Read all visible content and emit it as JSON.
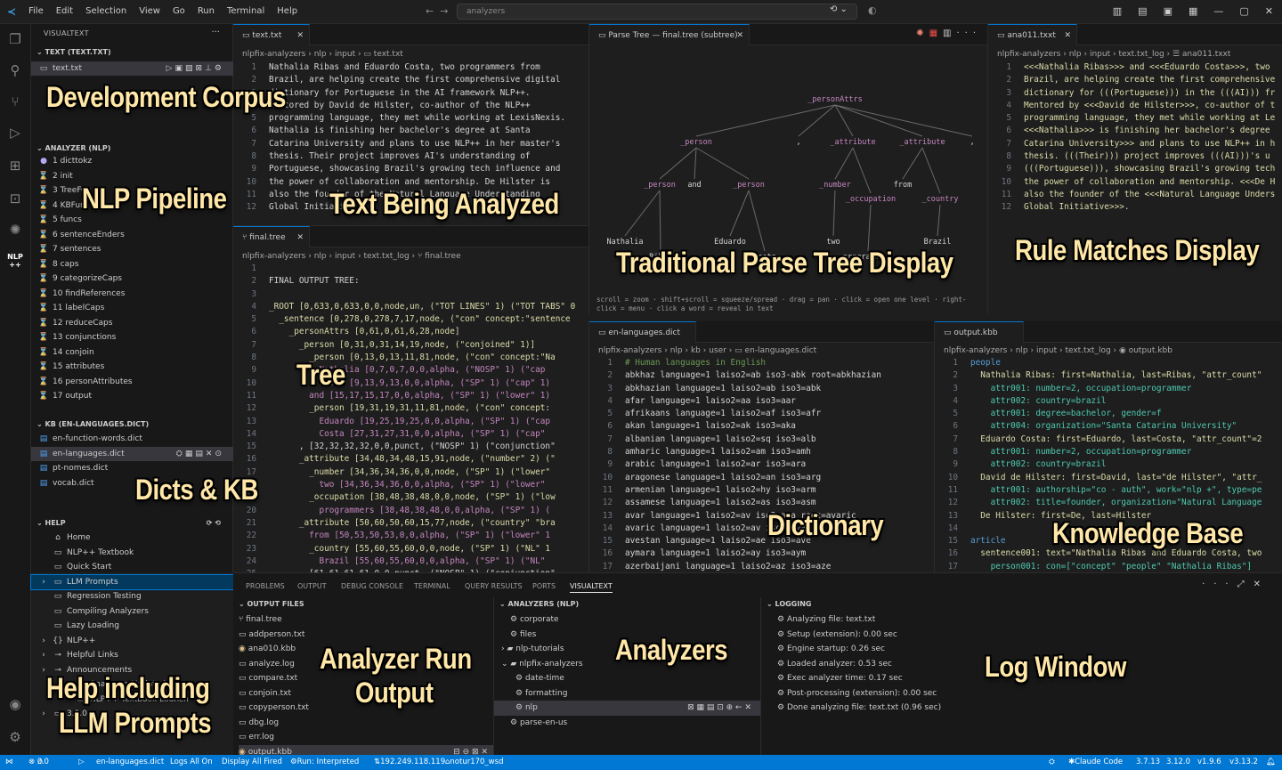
{
  "titlebar": {
    "menu": [
      "File",
      "Edit",
      "Selection",
      "View",
      "Go",
      "Run",
      "Terminal",
      "Help"
    ],
    "search_value": "analyzers"
  },
  "sidebar": {
    "header": "VISUALTEXT",
    "text_section": "TEXT (TEXT.TXT)",
    "text_file": "text.txt",
    "analyzer_section": "ANALYZER (NLP)",
    "passes": [
      "1 dicttokz",
      "2 init",
      "3 TreeFun",
      "4 KBFun",
      "5 funcs",
      "6 sentenceEnders",
      "7 sentences",
      "8 caps",
      "9 categorizeCaps",
      "10 findReferences",
      "11 labelCaps",
      "12 reduceCaps",
      "13 conjunctions",
      "14 conjoin",
      "15 attributes",
      "16 personAttributes",
      "17 output"
    ],
    "kb_section": "KB (EN-LANGUAGES.DICT)",
    "kb_files": [
      "en-function-words.dict",
      "en-languages.dict",
      "pt-nomes.dict",
      "vocab.dict"
    ],
    "help_section": "HELP",
    "help_items": [
      "Home",
      "NLP++ Textbook",
      "Quick Start",
      "LLM Prompts",
      "Regression Testing",
      "Compiling Analyzers",
      "Lazy Loading",
      "NLP++",
      "Helpful Links",
      "Announcements",
      "Analyzers Updated",
      "NLP++ Textbook Launch",
      "3.9.0"
    ]
  },
  "editor1": {
    "tab": "text.txt",
    "crumb": [
      "nlpfix-analyzers",
      "nlp",
      "input",
      "text.txt"
    ],
    "lines": [
      "Nathalia Ribas and Eduardo Costa, two programmers from",
      "Brazil, are helping create the first comprehensive digital",
      "dictionary for Portuguese in the AI framework NLP++.",
      "Mentored by David de Hilster, co-author of the NLP++",
      "programming language, they met while working at LexisNexis.",
      "Nathalia is finishing her bachelor's degree at Santa",
      "Catarina University and plans to use NLP++ in her master's",
      "thesis. Their project improves AI's understanding of",
      "Portuguese, showcasing Brazil's growing tech influence and",
      "the power of collaboration and mentorship. De Hilster is",
      "also the founder of the Natural Language Understanding",
      "Global Initiative."
    ]
  },
  "editor2": {
    "tab": "final.tree",
    "crumb": [
      "nlpfix-analyzers",
      "nlp",
      "input",
      "text.txt_log",
      "final.tree"
    ],
    "lines": [
      "",
      "FINAL OUTPUT TREE:",
      "",
      "_ROOT [0,633,0,633,0,0,node,un, (\"TOT LINES\" 1) (\"TOT TABS\" 0",
      "  _sentence [0,278,0,278,7,17,node, (\"con\" concept:\"sentence",
      "    _personAttrs [0,61,0,61,6,28,node]",
      "      _person [0,31,0,31,14,19,node, (\"conjoined\" 1)]",
      "        _person [0,13,0,13,11,81,node, (\"con\" concept:\"Na",
      "          Nathalia [0,7,0,7,0,0,alpha, (\"NOSP\" 1) (\"cap",
      "          Ribas [9,13,9,13,0,0,alpha, (\"SP\" 1) (\"cap\" 1)",
      "        and [15,17,15,17,0,0,alpha, (\"SP\" 1) (\"lower\" 1)",
      "        _person [19,31,19,31,11,81,node, (\"con\" concept:",
      "          Eduardo [19,25,19,25,0,0,alpha, (\"SP\" 1) (\"cap",
      "          Costa [27,31,27,31,0,0,alpha, (\"SP\" 1) (\"cap\"",
      "      , [32,32,32,32,0,0,punct, (\"NOSP\" 1) (\"conjunction\"",
      "      _attribute [34,48,34,48,15,91,node, (\"number\" 2) (\"",
      "        _number [34,36,34,36,0,0,node, (\"SP\" 1) (\"lower\"",
      "          two [34,36,34,36,0,0,alpha, (\"SP\" 1) (\"lower\"",
      "        _occupation [38,48,38,48,0,0,node, (\"SP\" 1) (\"low",
      "          programmers [38,48,38,48,0,0,alpha, (\"SP\" 1) (",
      "      _attribute [50,60,50,60,15,77,node, (\"country\" \"bra",
      "        from [50,53,50,53,0,0,alpha, (\"SP\" 1) (\"lower\" 1",
      "        _country [55,60,55,60,0,0,node, (\"SP\" 1) (\"NL\" 1",
      "          Brazil [55,60,55,60,0,0,alpha, (\"SP\" 1) (\"NL\"",
      "      , [61,61,61,61,0,0,punct, (\"NOSP\" 1) (\"conjunction\""
    ]
  },
  "parsetree": {
    "tab": "Parse Tree — final.tree (subtree)",
    "nodes": [
      "_personAttrs",
      "_person",
      ",",
      "_attribute",
      "_attribute",
      ",",
      "_person",
      "and",
      "_person",
      "_number",
      "from",
      "_occupation",
      "_country",
      "Nathalia",
      "Ribas",
      "Eduardo",
      "Costa",
      "two",
      "programmers",
      "Brazil"
    ],
    "help": "scroll = zoom · shift+scroll = squeeze/spread · drag = pan · click = open one level · right-click = menu · click a word = reveal in text"
  },
  "editor3": {
    "tab": "ana011.txxt",
    "crumb": [
      "nlpfix-analyzers",
      "nlp",
      "input",
      "text.txt_log",
      "ana011.txxt"
    ],
    "lines": [
      "<<<Nathalia Ribas>>> and <<<Eduardo Costa>>>, two",
      "Brazil, are helping create the first comprehensive",
      "dictionary for (((Portuguese))) in the (((AI))) fr",
      "Mentored by <<<David de Hilster>>>, co-author of t",
      "programming language, they met while working at Le",
      "<<<Nathalia>>> is finishing her bachelor's degree",
      "Catarina University>>> and plans to use NLP++ in h",
      "thesis. (((Their))) project improves (((AI)))'s u",
      "(((Portuguese))), showcasing Brazil's growing tech",
      "the power of collaboration and mentorship. <<<De H",
      "also the founder of the <<<Natural Language Unders",
      "Global Initiative>>>."
    ]
  },
  "editor4": {
    "tab": "en-languages.dict",
    "crumb": [
      "nlpfix-analyzers",
      "nlp",
      "kb",
      "user",
      "en-languages.dict"
    ],
    "lines": [
      "# Human languages in English",
      "abkhaz language=1 laiso2=ab iso3-abk root=abkhazian",
      "abkhazian language=1 laiso2=ab iso3=abk",
      "afar language=1 laiso2=aa iso3=aar",
      "afrikaans language=1 laiso2=af iso3=afr",
      "akan language=1 laiso2=ak iso3=aka",
      "albanian language=1 laiso2=sq iso3=alb",
      "amharic language=1 laiso2=am iso3=amh",
      "arabic language=1 laiso2=ar iso3=ara",
      "aragonese language=1 laiso2=an iso3=arg",
      "armenian language=1 laiso2=hy iso3=arm",
      "assamese language=1 laiso2=as iso3=asm",
      "avar language=1 laiso2=av iso3=ava root=avaric",
      "avaric language=1 laiso2=av iso3=ava",
      "avestan language=1 laiso2=ae iso3=ave",
      "aymara language=1 laiso2=ay iso3=aym",
      "azerbaijani language=1 laiso2=az iso3=aze"
    ]
  },
  "editor5": {
    "tab": "output.kbb",
    "crumb": [
      "nlpfix-analyzers",
      "nlp",
      "input",
      "text.txt_log",
      "output.kbb"
    ],
    "lines": [
      "people",
      "  Nathalia Ribas: first=Nathalia, last=Ribas, \"attr_count\"",
      "    attr001: number=2, occupation=programmer",
      "    attr002: country=brazil",
      "    attr001: degree=bachelor, gender=f",
      "    attr004: organization=\"Santa Catarina University\"",
      "  Eduardo Costa: first=Eduardo, last=Costa, \"attr_count\"=2",
      "    attr001: number=2, occupation=programmer",
      "    attr002: country=brazil",
      "  David de Hilster: first=David, last=\"de Hilster\", \"attr_",
      "    attr001: authorship=\"co - auth\", work=\"nlp +\", type=pe",
      "    attr002: title=founder, organization=\"Natural Language",
      "  De Hilster: first=De, last=Hilster",
      "",
      "article",
      "  sentence001: text=\"Nathalia Ribas and Eduardo Costa, two",
      "    person001: con=[\"concept\" \"people\" \"Nathalia Ribas\"]"
    ]
  },
  "panel": {
    "tabs": [
      "PROBLEMS",
      "OUTPUT",
      "DEBUG CONSOLE",
      "TERMINAL",
      "QUERY RESULTS",
      "PORTS",
      "VISUALTEXT"
    ],
    "output_files_title": "OUTPUT FILES",
    "output_files": [
      "final.tree",
      "addperson.txt",
      "ana010.kbb",
      "analyze.log",
      "compare.txt",
      "conjoin.txt",
      "copyperson.txt",
      "dbg.log",
      "err.log",
      "output.kbb"
    ],
    "analyzers_title": "ANALYZERS (NLP)",
    "analyzers": [
      "corporate",
      "files",
      "nlp-tutorials",
      "nlpfix-analyzers",
      "date-time",
      "formatting",
      "nlp",
      "parse-en-us"
    ],
    "logging_title": "LOGGING",
    "logging": [
      "Analyzing file: text.txt",
      "Setup (extension): 0.00 sec",
      "Engine startup: 0.26 sec",
      "Loaded analyzer: 0.53 sec",
      "Exec analyzer time: 0.17 sec",
      "Post-processing (extension): 0.00 sec",
      "Done analyzing file: text.txt   (0.96 sec)"
    ]
  },
  "status": {
    "errors": "0",
    "warnings": "0",
    "dict": "en-languages.dict",
    "logs": "Logs All On",
    "display": "Display All Fired",
    "run": "Run: Interpreted",
    "ip": "192.249.118.119",
    "ssh": "notur170_wsd",
    "claude": "Claude Code",
    "v1": "3.7.13",
    "v2": "3.12.0",
    "v3": "v1.9.6",
    "v4": "v3.13.2"
  },
  "overlays": {
    "dev_corpus": "Development Corpus",
    "nlp_pipeline": "NLP Pipeline",
    "text_analyzed": "Text Being Analyzed",
    "parse_tree": "Traditional Parse Tree Display",
    "rule_matches": "Rule Matches Display",
    "tree": "Tree",
    "dicts_kb": "Dicts & KB",
    "dictionary": "Dictionary",
    "knowledge_base": "Knowledge Base",
    "analyzer_run": "Analyzer Run",
    "output": "Output",
    "analyzers": "Analyzers",
    "log_window": "Log Window",
    "help1": "Help including",
    "help2": "LLM Prompts"
  }
}
